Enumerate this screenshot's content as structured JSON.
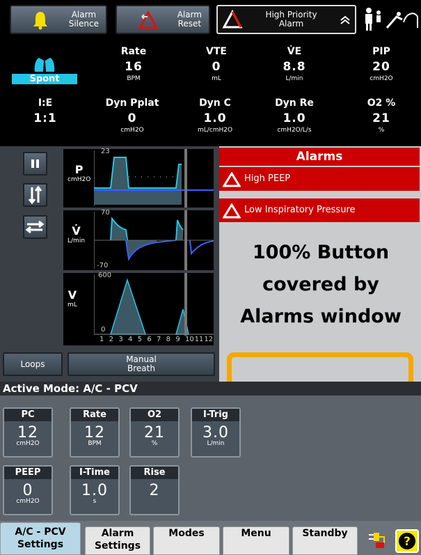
{
  "topbar": {
    "alarm_silence": [
      "Alarm",
      "Silence"
    ],
    "alarm_reset": [
      "Alarm",
      "Reset"
    ],
    "high_priority": [
      "High Priority",
      "Alarm"
    ]
  },
  "numerics": {
    "spont_label": "Spont",
    "row1": [
      {
        "label": "Rate",
        "value": "16",
        "unit": "BPM"
      },
      {
        "label": "VTE",
        "value": "0",
        "unit": "mL"
      },
      {
        "label": "V̇E",
        "value": "8.8",
        "unit": "L/min"
      },
      {
        "label": "PIP",
        "value": "20",
        "unit": "cmH2O"
      }
    ],
    "row2": [
      {
        "label": "I:E",
        "value": "1:1",
        "unit": ""
      },
      {
        "label": "Dyn Pplat",
        "value": "0",
        "unit": "cmH2O"
      },
      {
        "label": "Dyn C",
        "value": "1.0",
        "unit": "mL/cmH2O"
      },
      {
        "label": "Dyn Re",
        "value": "1.0",
        "unit": "cmH2O/L/s"
      },
      {
        "label": "O2 %",
        "value": "21",
        "unit": "%"
      }
    ]
  },
  "graphs": {
    "pressure": {
      "label": "P",
      "unit": "cmH2O",
      "ymax": "23",
      "ymin": "0"
    },
    "flow": {
      "label": "V̇",
      "unit": "L/min",
      "ymax": "70",
      "ymin": "-70"
    },
    "volume": {
      "label": "V",
      "unit": "mL",
      "ymax": "600",
      "ymin": "0"
    },
    "x_ticks": [
      "1",
      "2",
      "3",
      "4",
      "5",
      "6",
      "7",
      "8",
      "9",
      "10",
      "11",
      "12"
    ]
  },
  "alarms": {
    "title": "Alarms",
    "items": [
      "High PEEP",
      "Low Inspiratory Pressure"
    ],
    "annotation": "100% Button covered by Alarms window"
  },
  "buttons": {
    "loops": "Loops",
    "manual_breath": [
      "Manual",
      "Breath"
    ]
  },
  "active_mode": "Active Mode: A/C - PCV",
  "settings": [
    {
      "label": "PC",
      "value": "12",
      "unit": "cmH2O"
    },
    {
      "label": "Rate",
      "value": "12",
      "unit": "BPM"
    },
    {
      "label": "O2",
      "value": "21",
      "unit": "%"
    },
    {
      "label": "I-Trig",
      "value": "3.0",
      "unit": "L/min"
    },
    {
      "label": "PEEP",
      "value": "0",
      "unit": "cmH2O"
    },
    {
      "label": "I-Time",
      "value": "1.0",
      "unit": "s"
    },
    {
      "label": "Rise",
      "value": "2",
      "unit": ""
    }
  ],
  "tabs": [
    {
      "line1": "A/C - PCV",
      "line2": "Settings"
    },
    {
      "line1": "Alarm",
      "line2": "Settings"
    },
    {
      "line1": "Modes",
      "line2": ""
    },
    {
      "line1": "Menu",
      "line2": ""
    },
    {
      "line1": "Standby",
      "line2": ""
    }
  ],
  "colors": {
    "alarm_red": "#cc0000",
    "accent_cyan": "#23c4e8",
    "highlight_orange": "#f5a800",
    "active_tab": "#b7d7e6"
  },
  "icons": [
    "bell-icon",
    "alarm-reset-icon",
    "warning-triangle-icon",
    "chevron-up-icon",
    "patient-icon",
    "lungs-icon",
    "pause-icon",
    "vertical-arrows-icon",
    "horizontal-arrows-icon",
    "plug-icon",
    "help-icon"
  ]
}
